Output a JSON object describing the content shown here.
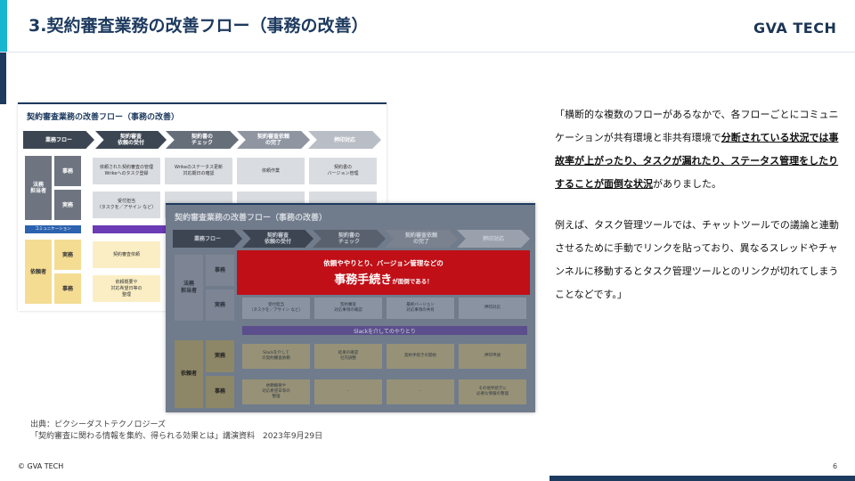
{
  "header": {
    "title": "3.契約審査業務の改善フロー（事務の改善）",
    "logo": "GVA TECH"
  },
  "slide_back": {
    "title": "契約審査業務の改善フロー（事務の改善）",
    "stages": [
      "業務フロー",
      "契約審査\n依頼の受付",
      "契約書の\nチェック",
      "契約審査依頼\nの完了",
      "押印対応"
    ],
    "row_groups": {
      "legal": "法務\n担当者",
      "requester": "依頼者"
    },
    "row_types": [
      "事務",
      "実務"
    ],
    "cells": {
      "legal_jimu": [
        "依頼された契約審査の管理\nWrikeへのタスク登録",
        "Wrikeのステータス更新\n対応期日の確認",
        "依頼作業",
        "契約書の\nバージョン管理"
      ],
      "legal_jitsumu": [
        "受付担当\n（タスクを／アサイン など）",
        "",
        "",
        ""
      ],
      "comm": "コミュニケーション",
      "req_jitsumu": [
        "契約審査依頼",
        "",
        "",
        ""
      ],
      "req_jimu": [
        "依頼概要や\n対応希望日等の\n整理",
        "",
        "",
        ""
      ]
    }
  },
  "slide_front": {
    "title": "契約審査業務の改善フロー（事務の改善）",
    "stages": [
      "業務フロー",
      "契約審査\n依頼の受付",
      "契約書の\nチェック",
      "契約審査依頼\nの完了",
      "押印対応"
    ],
    "row_groups": {
      "legal": "法務\n担当者",
      "requester": "依頼者"
    },
    "row_types": {
      "jimu": "事務",
      "jitsumu": "実務"
    },
    "slack_bar": "Slackを介してのやりとり",
    "legal_jitsumu_cells": [
      "受付担当\n（タスクを／アサイン など）",
      "契約審査\n対応事項の確認",
      "最終バージョン\n対応事項の共有",
      "押印対応"
    ],
    "req_jitsumu_cells": [
      "Slackを介して\nの契約審査依頼",
      "結果の確認\n社内調整",
      "契約手続きの開始",
      "押印申請"
    ],
    "req_jimu_cells": [
      "依頼概要や\n対応希望日等の\n整理",
      "-",
      "-",
      "その他手続きに\n必要な情報の整理"
    ],
    "callout": {
      "line1": "依頼ややりとり、バージョン管理などの",
      "line2": "事務手続き",
      "line2_suffix": "が面倒である！"
    }
  },
  "quote": {
    "p1_a": "「横断的な複数のフローがあるなかで、各フローごとにコミュニケーションが共有環境と非共有環境で",
    "p1_b": "分断されている状況では事故率が上がったり、タスクが漏れたり、ステータス管理をしたりすることが面倒な状況",
    "p1_c": "がありました。",
    "p2": "例えば、タスク管理ツールでは、チャットツールでの議論と連動させるために手動でリンクを貼っており、異なるスレッドやチャンネルに移動するとタスク管理ツールとのリンクが切れてしまうことなどです。」"
  },
  "source": {
    "line1": "出典：ピクシーダストテクノロジーズ",
    "line2": "「契約審査に関わる情報を集約、得られる効果とは」講演資料　2023年9月29日"
  },
  "footer": {
    "copyright": "© GVA TECH",
    "page": "6"
  },
  "colors": {
    "navy": "#1d3a5f",
    "accent": "#18b6cf",
    "callout_red": "#c00f17",
    "purple": "#6a3bb4"
  }
}
